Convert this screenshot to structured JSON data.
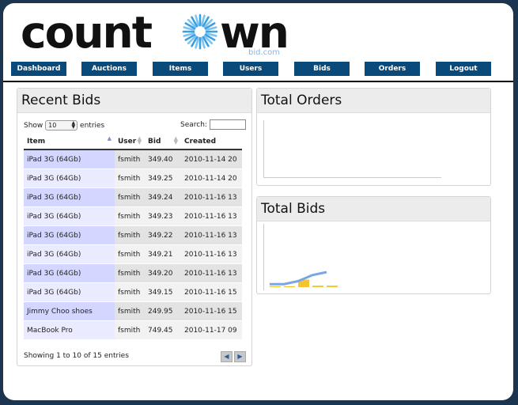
{
  "brand": {
    "logo_text": "countdown",
    "logo_sub": "bid.com",
    "accent": "#0a4a7a"
  },
  "nav": [
    "Dashboard",
    "Auctions",
    "Items",
    "Users",
    "Bids",
    "Orders",
    "Logout"
  ],
  "recent_bids": {
    "title": "Recent Bids",
    "show_label": "Show",
    "entries_value": "10",
    "entries_label": "entries",
    "search_label": "Search:",
    "search_value": "",
    "columns": [
      "Item",
      "User",
      "Bid",
      "Created"
    ],
    "rows": [
      [
        "iPad 3G (64Gb)",
        "fsmith",
        "349.40",
        "2010-11-14 20"
      ],
      [
        "iPad 3G (64Gb)",
        "fsmith",
        "349.25",
        "2010-11-14 20"
      ],
      [
        "iPad 3G (64Gb)",
        "fsmith",
        "349.24",
        "2010-11-16 13"
      ],
      [
        "iPad 3G (64Gb)",
        "fsmith",
        "349.23",
        "2010-11-16 13"
      ],
      [
        "iPad 3G (64Gb)",
        "fsmith",
        "349.22",
        "2010-11-16 13"
      ],
      [
        "iPad 3G (64Gb)",
        "fsmith",
        "349.21",
        "2010-11-16 13"
      ],
      [
        "iPad 3G (64Gb)",
        "fsmith",
        "349.20",
        "2010-11-16 13"
      ],
      [
        "iPad 3G (64Gb)",
        "fsmith",
        "349.15",
        "2010-11-16 15"
      ],
      [
        "Jimmy Choo shoes",
        "fsmith",
        "249.95",
        "2010-11-16 15"
      ],
      [
        "MacBook Pro",
        "fsmith",
        "749.45",
        "2010-11-17 09"
      ]
    ],
    "info": "Showing 1 to 10 of 15 entries",
    "prev_icon": "prev-arrow-icon",
    "next_icon": "next-arrow-icon"
  },
  "total_orders": {
    "title": "Total Orders"
  },
  "total_bids": {
    "title": "Total Bids"
  },
  "chart_data": {
    "type": "line",
    "series": [
      {
        "color": "#7aa6e6",
        "values": [
          1,
          1,
          2,
          4,
          5
        ]
      },
      {
        "color": "#f4c430",
        "values": [
          0.3,
          0.3,
          2.5,
          0.5,
          0.5
        ]
      }
    ],
    "colors": {
      "blue": "#7aa6e6",
      "yellow": "#f4c430"
    }
  }
}
